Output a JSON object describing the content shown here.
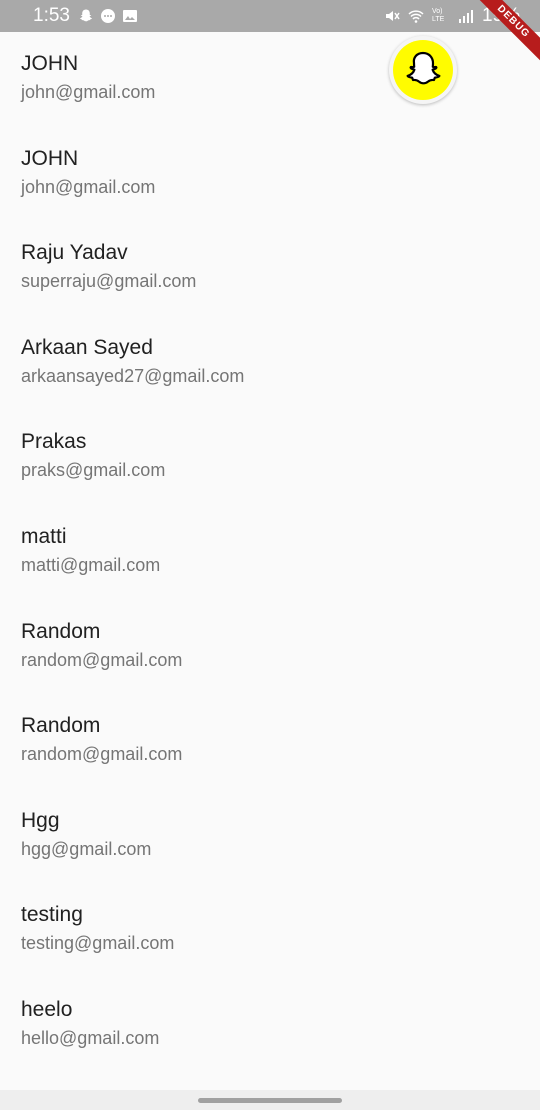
{
  "status_bar": {
    "time": "1:53",
    "battery": "19%",
    "network": "Vo) LTE",
    "icons_left": [
      "snapchat-notification-icon",
      "message-icon",
      "image-icon"
    ],
    "icons_right": [
      "mute-icon",
      "wifi-icon",
      "volte-icon",
      "signal-icon",
      "battery-icon"
    ]
  },
  "debug_banner": "DEBUG",
  "users": [
    {
      "name": "JOHN",
      "email": "john@gmail.com"
    },
    {
      "name": "JOHN",
      "email": "john@gmail.com"
    },
    {
      "name": "Raju Yadav",
      "email": "superraju@gmail.com"
    },
    {
      "name": "Arkaan Sayed",
      "email": "arkaansayed27@gmail.com"
    },
    {
      "name": "Prakas",
      "email": "praks@gmail.com"
    },
    {
      "name": "matti",
      "email": "matti@gmail.com"
    },
    {
      "name": "Random",
      "email": "random@gmail.com"
    },
    {
      "name": "Random",
      "email": "random@gmail.com"
    },
    {
      "name": "Hgg",
      "email": "hgg@gmail.com"
    },
    {
      "name": "testing",
      "email": "testing@gmail.com"
    },
    {
      "name": "heelo",
      "email": "hello@gmail.com"
    }
  ],
  "snap_button": {
    "icon": "snapchat-ghost-icon",
    "color": "#fffc00"
  },
  "colors": {
    "background": "#fafafa",
    "status_bar": "#a9a9a9",
    "name_text": "#212121",
    "email_text": "#757575",
    "debug": "#b71c1c"
  }
}
